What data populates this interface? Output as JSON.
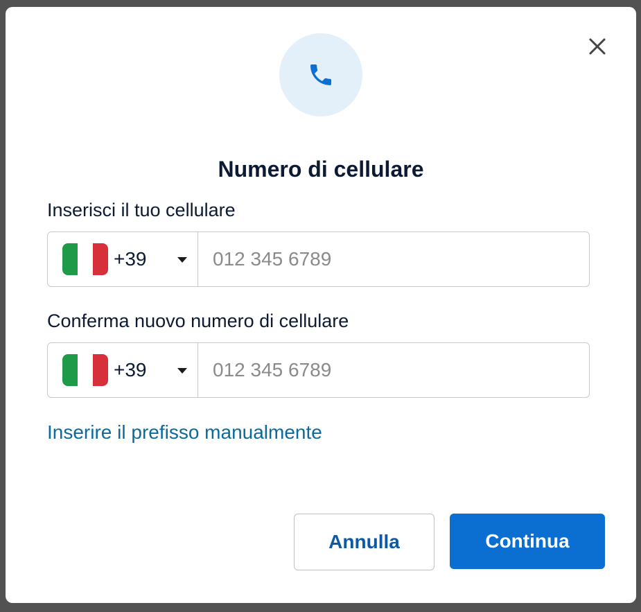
{
  "modal": {
    "title": "Numero di cellulare",
    "close_icon": "close-icon",
    "hero_icon": "phone-icon"
  },
  "phone_field": {
    "label": "Inserisci il tuo cellulare",
    "country_code": "+39",
    "flag": "italy-flag",
    "placeholder": "012 345 6789",
    "value": ""
  },
  "confirm_field": {
    "label": "Conferma nuovo numero di cellulare",
    "country_code": "+39",
    "flag": "italy-flag",
    "placeholder": "012 345 6789",
    "value": ""
  },
  "manual_prefix_link": "Inserire il prefisso manualmente",
  "buttons": {
    "cancel": "Annulla",
    "continue": "Continua"
  },
  "colors": {
    "primary": "#0b6fd1",
    "link": "#0a6a9e",
    "title": "#0c1b33",
    "hero_bg": "#e3f0fa",
    "flag_green": "#1f9a48",
    "flag_white": "#ffffff",
    "flag_red": "#d6303a"
  }
}
